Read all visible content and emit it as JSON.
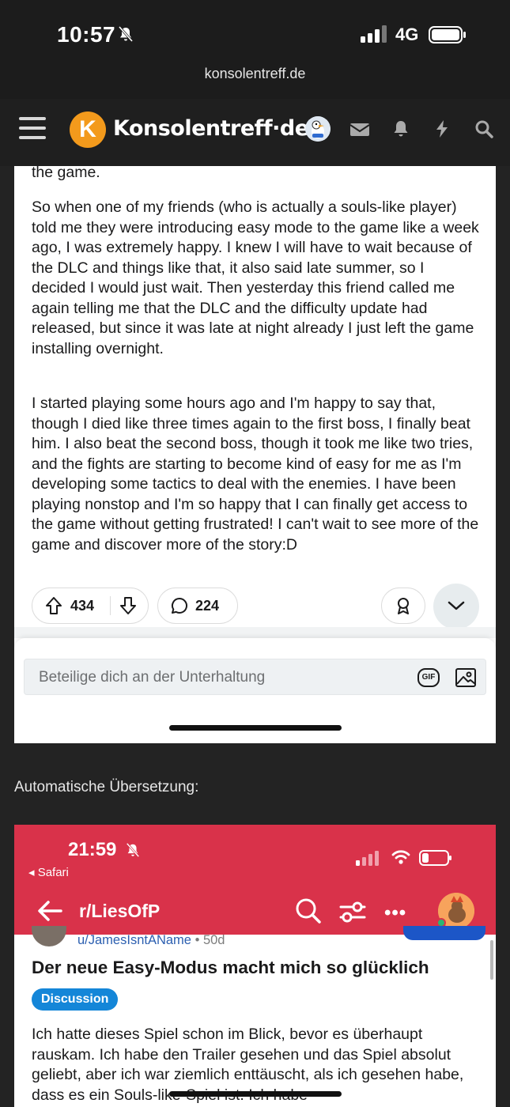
{
  "status_bar": {
    "time": "10:57",
    "network": "4G"
  },
  "browser": {
    "url": "konsolentreff.de"
  },
  "site_header": {
    "logo_letter": "K",
    "logo_text": "Konsolentreff·de"
  },
  "post": {
    "paragraphs": [
      "the game.",
      "So when one of my friends (who is actually a souls-like player) told me they were introducing easy mode to the game like a week ago, I was extremely happy. I knew I will have to wait because of the DLC and things like that, it also said late summer, so I decided I would just wait. Then yesterday this friend called me again telling me that the DLC and the difficulty update had released, but since it was late at night already I just left the game installing overnight.",
      "I started playing some hours ago and I'm happy to say that, though I died like three times again to the first boss, I finally beat him. I also beat the second boss, though it took me like two tries, and the fights are starting to become kind of easy for me as I'm developing some tactics to deal with the enemies. I have been playing nonstop and I'm so happy that I can finally get access to the game without getting frustrated! I can't wait to see more of the game and discover more of the story:D"
    ],
    "upvotes": "434",
    "comments": "224",
    "reply_placeholder": "Beteilige dich an der Unterhaltung",
    "gif_label": "GIF"
  },
  "translation_label": "Automatische Übersetzung:",
  "translated_screenshot": {
    "time": "21:59",
    "back_app": "◂ Safari",
    "subreddit": "r/LiesOfP",
    "more": "•••",
    "user": "u/JamesIsntAName",
    "age": "• 50d",
    "title": "Der neue Easy-Modus macht mich so glücklich",
    "flair": "Discussion",
    "body": "Ich hatte dieses Spiel schon im Blick, bevor es überhaupt rauskam. Ich habe den Trailer gesehen und das Spiel absolut geliebt, aber ich war ziemlich enttäuscht, als ich gesehen habe, dass es ein Souls-like-Spiel ist. Ich habe"
  },
  "colors": {
    "reddit_red": "#d9324a",
    "logo_orange": "#f39a1c",
    "flair_blue": "#1486d8"
  }
}
